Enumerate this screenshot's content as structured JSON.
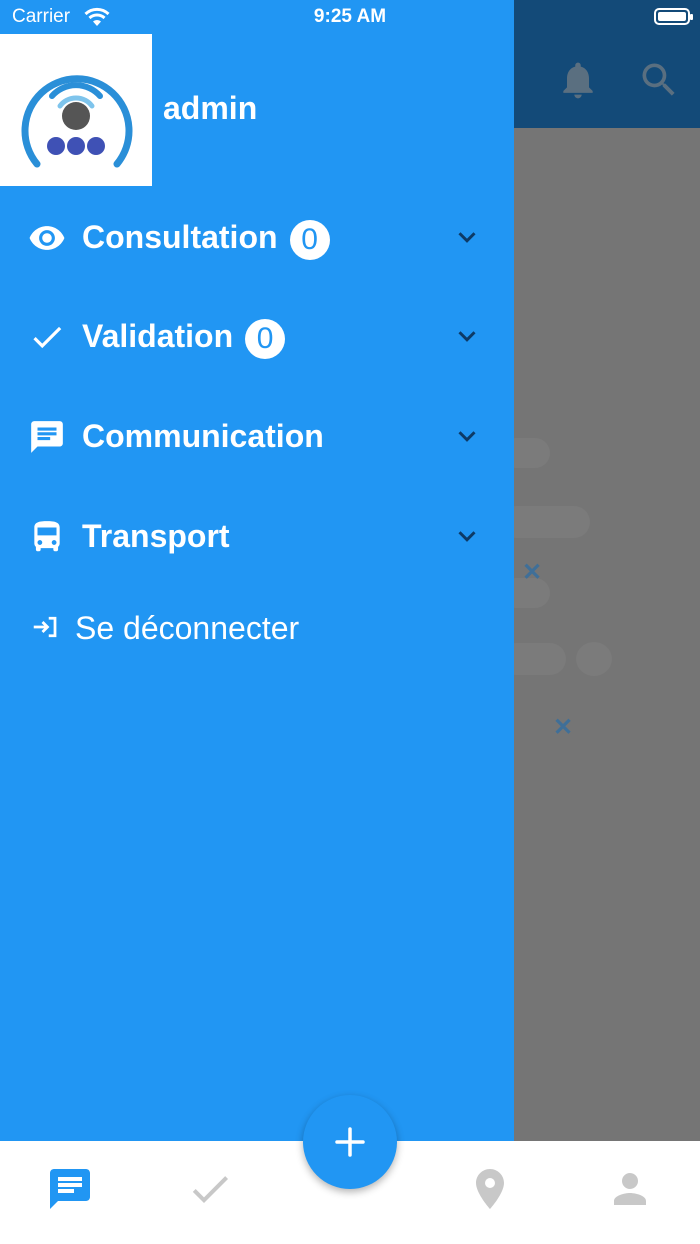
{
  "status_bar": {
    "carrier": "Carrier",
    "time": "9:25 AM"
  },
  "drawer": {
    "username": "admin",
    "menu": [
      {
        "label": "Consultation",
        "badge": "0",
        "icon": "eye-icon"
      },
      {
        "label": "Validation",
        "badge": "0",
        "icon": "check-icon"
      },
      {
        "label": "Communication",
        "icon": "message-icon"
      },
      {
        "label": "Transport",
        "icon": "bus-icon"
      }
    ],
    "logout_label": "Se déconnecter"
  },
  "header": {
    "icons": [
      "bell-icon",
      "search-icon"
    ]
  },
  "tabbar": {
    "tabs": [
      "messages-icon",
      "check-icon",
      "location-pin-icon",
      "person-icon"
    ],
    "fab_icon": "plus-icon"
  },
  "colors": {
    "primary": "#2196f3",
    "header_dark": "#134a78",
    "overlay": "#757575",
    "tab_inactive": "#c8c8c8"
  }
}
